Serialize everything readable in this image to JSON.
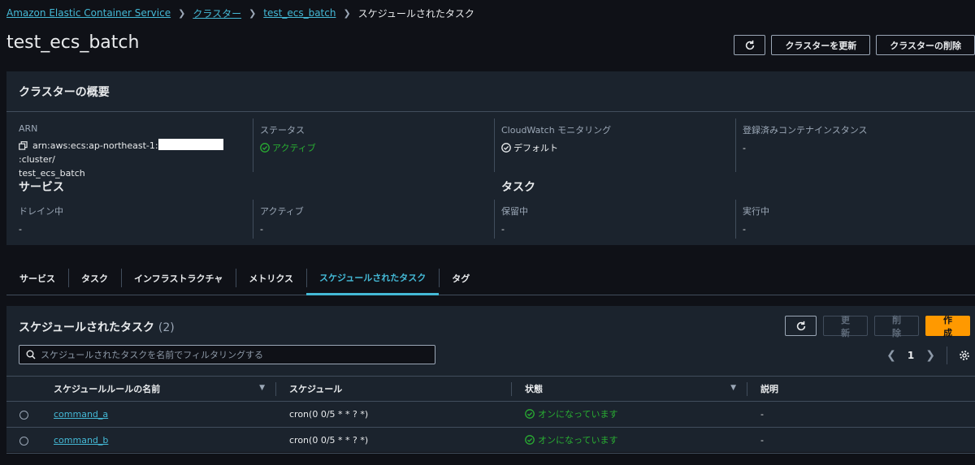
{
  "breadcrumb": {
    "items": [
      "Amazon Elastic Container Service",
      "クラスター",
      "test_ecs_batch"
    ],
    "current": "スケジュールされたタスク"
  },
  "page": {
    "title": "test_ecs_batch",
    "update_cluster": "クラスターを更新",
    "delete_cluster": "クラスターの削除"
  },
  "overview": {
    "title": "クラスターの概要",
    "arn_label": "ARN",
    "arn_prefix": "arn:aws:ecs:ap-northeast-1:",
    "arn_suffix": ":cluster/",
    "arn_cluster": "test_ecs_batch",
    "status_label": "ステータス",
    "status_value": "アクティブ",
    "cloudwatch_label": "CloudWatch モニタリング",
    "cloudwatch_value": "デフォルト",
    "instances_label": "登録済みコンテナインスタンス",
    "instances_value": "-",
    "services_heading": "サービス",
    "draining_label": "ドレイン中",
    "draining_value": "-",
    "active_label": "アクティブ",
    "active_value": "-",
    "tasks_heading": "タスク",
    "pending_label": "保留中",
    "pending_value": "-",
    "running_label": "実行中",
    "running_value": "-"
  },
  "tabs": [
    "サービス",
    "タスク",
    "インフラストラクチャ",
    "メトリクス",
    "スケジュールされたタスク",
    "タグ"
  ],
  "tasks": {
    "title": "スケジュールされたタスク",
    "count": "(2)",
    "update": "更新",
    "delete": "削除",
    "create": "作成",
    "search_placeholder": "スケジュールされたタスクを名前でフィルタリングする",
    "page": "1",
    "columns": [
      "スケジュールルールの名前",
      "スケジュール",
      "状態",
      "説明"
    ],
    "rows": [
      {
        "name": "command_a",
        "schedule": "cron(0 0/5 * * ? *)",
        "state": "オンになっています",
        "description": "-"
      },
      {
        "name": "command_b",
        "schedule": "cron(0 0/5 * * ? *)",
        "state": "オンになっています",
        "description": "-"
      }
    ]
  },
  "colors": {
    "accent": "#44b9d6",
    "success": "#29ad32",
    "primary": "#ff9900"
  }
}
